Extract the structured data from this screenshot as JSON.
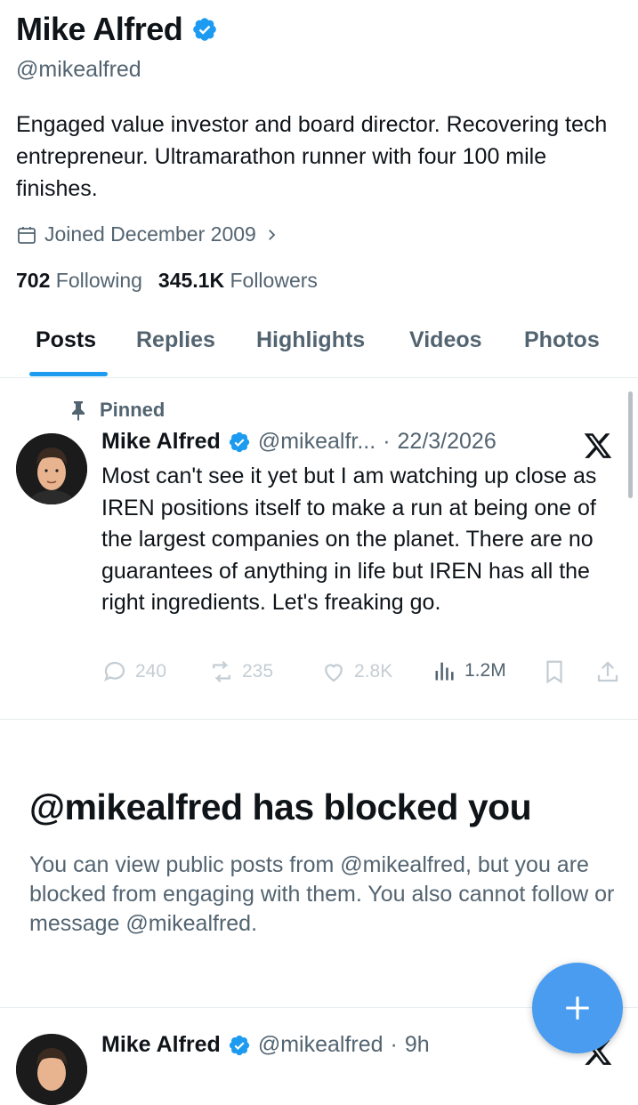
{
  "profile": {
    "name": "Mike Alfred",
    "handle": "@mikealfred",
    "bio": "Engaged value investor and board director. Recovering tech entrepreneur. Ultramarathon runner with four 100 mile finishes.",
    "joined": "Joined December 2009",
    "following_count": "702",
    "following_label": "Following",
    "followers_count": "345.1K",
    "followers_label": "Followers"
  },
  "tabs": [
    {
      "label": "Posts",
      "active": true
    },
    {
      "label": "Replies",
      "active": false
    },
    {
      "label": "Highlights",
      "active": false
    },
    {
      "label": "Videos",
      "active": false
    },
    {
      "label": "Photos",
      "active": false
    }
  ],
  "pinned_post": {
    "pinned_label": "Pinned",
    "author": "Mike Alfred",
    "handle": "@mikealfr...",
    "separator": "·",
    "date": "22/3/2026",
    "text": "Most can't see it yet but I am watching up close as IREN positions itself to make a run at being one of the largest companies on the planet. There are no guarantees of anything in life but IREN has all the right ingredients. Let's freaking go.",
    "replies": "240",
    "reposts": "235",
    "likes": "2.8K",
    "views": "1.2M"
  },
  "blocked": {
    "title": "@mikealfred has blocked you",
    "body": "You can view public posts from @mikealfred, but you are blocked from engaging with them. You also cannot follow or message @mikealfred."
  },
  "second_post": {
    "author": "Mike Alfred",
    "handle": "@mikealfred",
    "separator": "·",
    "time": "9h"
  },
  "colors": {
    "accent": "#1d9bf0",
    "fab": "#4a9cf0",
    "muted_text": "#536471",
    "text": "#0f1419"
  },
  "icons": [
    "verified-badge-icon",
    "calendar-icon",
    "chevron-right-icon",
    "pin-icon",
    "x-logo-icon",
    "reply-icon",
    "repost-icon",
    "like-icon",
    "views-icon",
    "bookmark-icon",
    "share-icon",
    "compose-plus-icon"
  ]
}
